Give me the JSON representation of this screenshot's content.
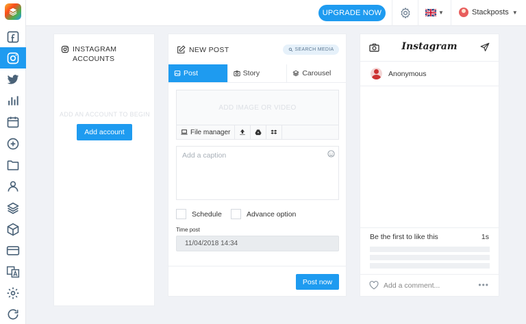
{
  "topbar": {
    "upgrade_label": "UPGRADE NOW",
    "username": "Stackposts"
  },
  "sidebar": {
    "items": [
      {
        "icon": "facebook-icon"
      },
      {
        "icon": "instagram-icon",
        "active": true
      },
      {
        "icon": "twitter-icon"
      },
      {
        "icon": "bar-chart-icon"
      },
      {
        "icon": "calendar-icon"
      },
      {
        "icon": "plus-circle-icon"
      },
      {
        "icon": "folder-icon"
      },
      {
        "icon": "user-icon"
      },
      {
        "icon": "layers-icon"
      },
      {
        "icon": "box-icon"
      },
      {
        "icon": "credit-card-icon"
      },
      {
        "icon": "translate-icon"
      },
      {
        "icon": "settings-icon"
      },
      {
        "icon": "refresh-icon"
      }
    ]
  },
  "accounts": {
    "title": "INSTAGRAM ACCOUNTS",
    "empty_message": "ADD AN ACCOUNT TO BEGIN",
    "add_label": "Add account"
  },
  "post": {
    "title": "NEW POST",
    "search_media": "SEARCH MEDIA",
    "tabs": [
      {
        "label": "Post",
        "active": true
      },
      {
        "label": "Story"
      },
      {
        "label": "Carousel"
      }
    ],
    "media_placeholder": "ADD IMAGE OR VIDEO",
    "file_manager": "File manager",
    "caption_placeholder": "Add a caption",
    "schedule_label": "Schedule",
    "advance_label": "Advance option",
    "time_label": "Time post",
    "time_value": "11/04/2018 14:34",
    "post_now": "Post now"
  },
  "preview": {
    "brand": "Instagram",
    "username": "Anonymous",
    "likes_text": "Be the first to like this",
    "time_ago": "1s",
    "comment_placeholder": "Add a comment...",
    "more": "•••"
  },
  "colors": {
    "accent": "#1e9bf0",
    "sidebar_icon": "#4a6278"
  }
}
